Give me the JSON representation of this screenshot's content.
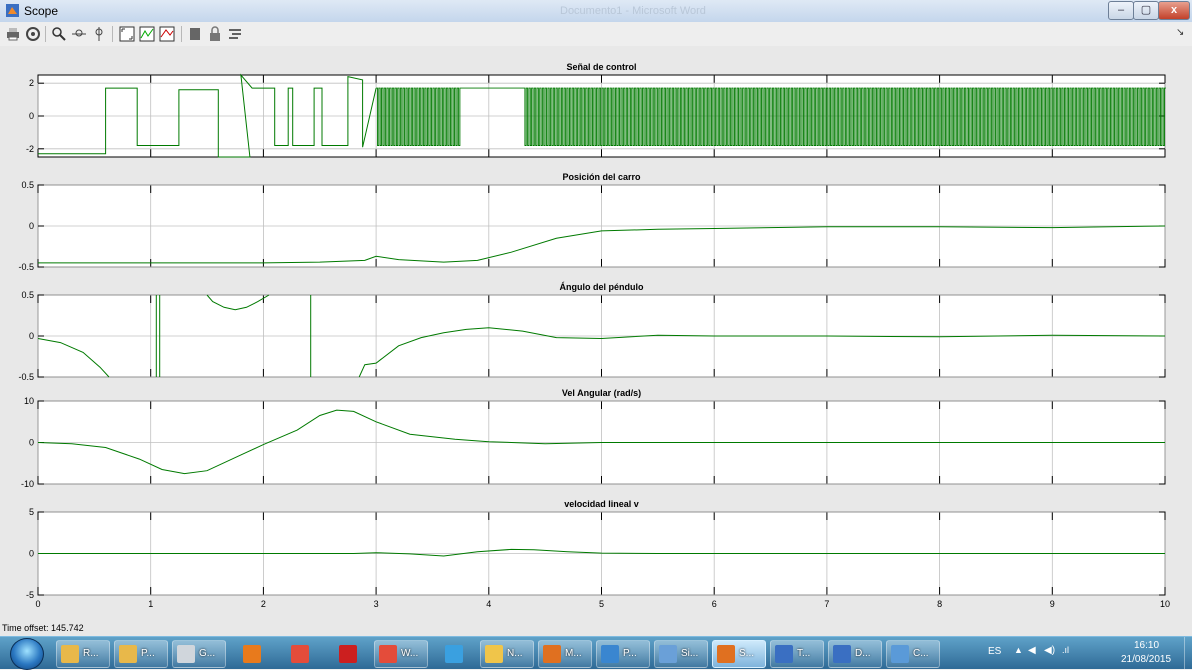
{
  "window": {
    "title": "Scope",
    "background_title": "Documento1 - Microsoft Word"
  },
  "controls": {
    "minimize": "–",
    "maximize": "▢",
    "close": "x"
  },
  "toolbar": {
    "buttons": [
      "print-icon",
      "parameters-icon",
      "zoom-icon",
      "zoom-x-icon",
      "zoom-y-icon",
      "autoscale-icon",
      "save-axes-icon",
      "restore-axes-icon",
      "floating-scope-icon",
      "lock-icon",
      "signal-selection-icon"
    ],
    "collapse_glyph": "↘"
  },
  "colors": {
    "signal": "#007a00",
    "plot_bg": "#ffffff",
    "grid": "#c0c0c0",
    "figure_bg": "#e8e8e8"
  },
  "time_offset": {
    "label": "Time offset:",
    "value": "145.742"
  },
  "chart_data": [
    {
      "type": "line",
      "title": "Señal de control",
      "xlim": [
        0,
        10
      ],
      "ylim": [
        -2.5,
        2.5
      ],
      "yticks": [
        "2",
        "0",
        "-2"
      ],
      "x": [
        0,
        0.6,
        0.6,
        0.88,
        0.88,
        1.25,
        1.25,
        1.6,
        1.6,
        1.88,
        1.8,
        1.9,
        2.0,
        2.1,
        2.1,
        2.22,
        2.22,
        2.26,
        2.26,
        2.45,
        2.45,
        2.52,
        2.52,
        2.75,
        2.75,
        2.88,
        2.88,
        3.0
      ],
      "y": [
        -2.3,
        -2.3,
        1.7,
        1.7,
        -1.8,
        -1.8,
        1.6,
        1.6,
        -2.5,
        -2.5,
        2.5,
        1.7,
        1.7,
        1.7,
        -1.8,
        -1.8,
        1.7,
        1.7,
        -1.8,
        -1.8,
        1.7,
        1.7,
        -1.8,
        -1.8,
        2.4,
        2.2,
        -1.9,
        1.7
      ],
      "note": "",
      "oscillation": {
        "from": 3.0,
        "to": 10.0,
        "min": -1.8,
        "max": 1.7,
        "gap_from": 3.75,
        "gap_to": 4.3,
        "gap_value": 1.7
      }
    },
    {
      "type": "line",
      "title": "Posición del carro",
      "xlim": [
        0,
        10
      ],
      "ylim": [
        -0.5,
        0.5
      ],
      "yticks": [
        "0.5",
        "0",
        "-0.5"
      ],
      "x": [
        0,
        1,
        2,
        2.5,
        2.9,
        3.0,
        3.2,
        3.6,
        3.9,
        4.2,
        4.6,
        5.0,
        5.5,
        6.0,
        7.0,
        8.0,
        9.0,
        10.0
      ],
      "y": [
        -0.45,
        -0.45,
        -0.45,
        -0.44,
        -0.42,
        -0.37,
        -0.41,
        -0.44,
        -0.42,
        -0.32,
        -0.15,
        -0.06,
        -0.04,
        -0.03,
        -0.01,
        -0.01,
        -0.02,
        0.0
      ]
    },
    {
      "type": "line",
      "title": "Ángulo del péndulo",
      "xlim": [
        0,
        10
      ],
      "ylim": [
        -0.5,
        0.5
      ],
      "yticks": [
        "0.5",
        "0",
        "-0.5"
      ],
      "segments": [
        {
          "x": [
            0,
            0.2,
            0.4,
            0.55,
            0.63
          ],
          "y": [
            -0.03,
            -0.08,
            -0.2,
            -0.38,
            -0.5
          ]
        },
        {
          "x": [
            1.05,
            1.05
          ],
          "y": [
            -0.5,
            0.5
          ]
        },
        {
          "x": [
            1.08,
            1.08
          ],
          "y": [
            -0.5,
            0.5
          ]
        },
        {
          "x": [
            1.5,
            1.55,
            1.65,
            1.75,
            1.85,
            1.95,
            2.05
          ],
          "y": [
            0.5,
            0.42,
            0.35,
            0.32,
            0.35,
            0.42,
            0.5
          ]
        },
        {
          "x": [
            2.42,
            2.42
          ],
          "y": [
            -0.5,
            0.5
          ]
        },
        {
          "x": [
            2.85,
            2.9,
            3.0,
            3.2,
            3.4,
            3.6,
            3.8,
            4.0,
            4.3,
            4.6,
            5.0,
            5.5,
            6.0,
            7.0,
            8.0,
            9.0,
            10.0
          ],
          "y": [
            -0.5,
            -0.35,
            -0.33,
            -0.12,
            -0.02,
            0.04,
            0.08,
            0.1,
            0.06,
            -0.02,
            -0.03,
            0.01,
            0.0,
            0.0,
            -0.01,
            0.01,
            0.0
          ]
        }
      ]
    },
    {
      "type": "line",
      "title": "Vel Angular (rad/s)",
      "xlim": [
        0,
        10
      ],
      "ylim": [
        -10,
        10
      ],
      "yticks": [
        "10",
        "0",
        "-10"
      ],
      "x": [
        0,
        0.3,
        0.6,
        0.9,
        1.1,
        1.3,
        1.5,
        1.8,
        2.0,
        2.3,
        2.5,
        2.65,
        2.8,
        3.0,
        3.3,
        3.7,
        4.0,
        4.5,
        5.0,
        6.0,
        7.0,
        8.0,
        9.0,
        10.0
      ],
      "y": [
        0,
        -0.3,
        -1.2,
        -4,
        -6.5,
        -7.5,
        -6.8,
        -3,
        -0.5,
        3,
        6.5,
        7.8,
        7.5,
        5,
        2,
        0.8,
        0.2,
        -0.3,
        0,
        0,
        0,
        0,
        0,
        0
      ]
    },
    {
      "type": "line",
      "title": "velocidad lineal v",
      "xlim": [
        0,
        10
      ],
      "ylim": [
        -5,
        5
      ],
      "yticks": [
        "5",
        "0",
        "-5"
      ],
      "xticks": [
        "0",
        "1",
        "2",
        "3",
        "4",
        "5",
        "6",
        "7",
        "8",
        "9",
        "10"
      ],
      "x": [
        0,
        2.8,
        3.0,
        3.3,
        3.6,
        3.9,
        4.2,
        4.4,
        4.7,
        5.0,
        5.5,
        6.0,
        10.0
      ],
      "y": [
        0,
        0,
        0.1,
        -0.05,
        -0.3,
        0.2,
        0.5,
        0.45,
        0.2,
        0.05,
        0,
        0,
        0
      ]
    }
  ],
  "taskbar": {
    "items": [
      {
        "name": "task-r",
        "label": "R...",
        "icon_color": "#e8b84a",
        "pinned": false,
        "active": false
      },
      {
        "name": "task-p-folder",
        "label": "P...",
        "icon_color": "#e8b84a",
        "pinned": false,
        "active": false
      },
      {
        "name": "task-g",
        "label": "G...",
        "icon_color": "#d0d6dc",
        "pinned": false,
        "active": false
      },
      {
        "name": "task-media",
        "label": "",
        "icon_color": "#e87a1c",
        "pinned": true,
        "active": false
      },
      {
        "name": "task-chrome",
        "label": "",
        "icon_color": "#e44c3a",
        "pinned": true,
        "active": false
      },
      {
        "name": "task-acrobat",
        "label": "",
        "icon_color": "#cc1f1f",
        "pinned": true,
        "active": false
      },
      {
        "name": "task-chrome-w",
        "label": "W...",
        "icon_color": "#e44c3a",
        "pinned": false,
        "active": false
      },
      {
        "name": "task-ie",
        "label": "",
        "icon_color": "#3aa0e0",
        "pinned": true,
        "active": false
      },
      {
        "name": "task-n",
        "label": "N...",
        "icon_color": "#f0c54a",
        "pinned": false,
        "active": false
      },
      {
        "name": "task-matlab",
        "label": "M...",
        "icon_color": "#e07020",
        "pinned": false,
        "active": false
      },
      {
        "name": "task-p-sim",
        "label": "P...",
        "icon_color": "#3a86d0",
        "pinned": false,
        "active": false
      },
      {
        "name": "task-simulink",
        "label": "Si...",
        "icon_color": "#6aa0d8",
        "pinned": false,
        "active": false
      },
      {
        "name": "task-scope",
        "label": "S...",
        "icon_color": "#e07020",
        "pinned": false,
        "active": true
      },
      {
        "name": "task-word-t",
        "label": "T...",
        "icon_color": "#3a6fc2",
        "pinned": false,
        "active": false
      },
      {
        "name": "task-word-d",
        "label": "D...",
        "icon_color": "#3a6fc2",
        "pinned": false,
        "active": false
      },
      {
        "name": "task-calc",
        "label": "C...",
        "icon_color": "#5a9ad8",
        "pinned": false,
        "active": false
      }
    ],
    "tray": {
      "language": "ES",
      "arrow": "▲",
      "flag": "◀",
      "volume": "◀)",
      "network": ".ıl",
      "time": "16:10",
      "date": "21/08/2015"
    }
  }
}
